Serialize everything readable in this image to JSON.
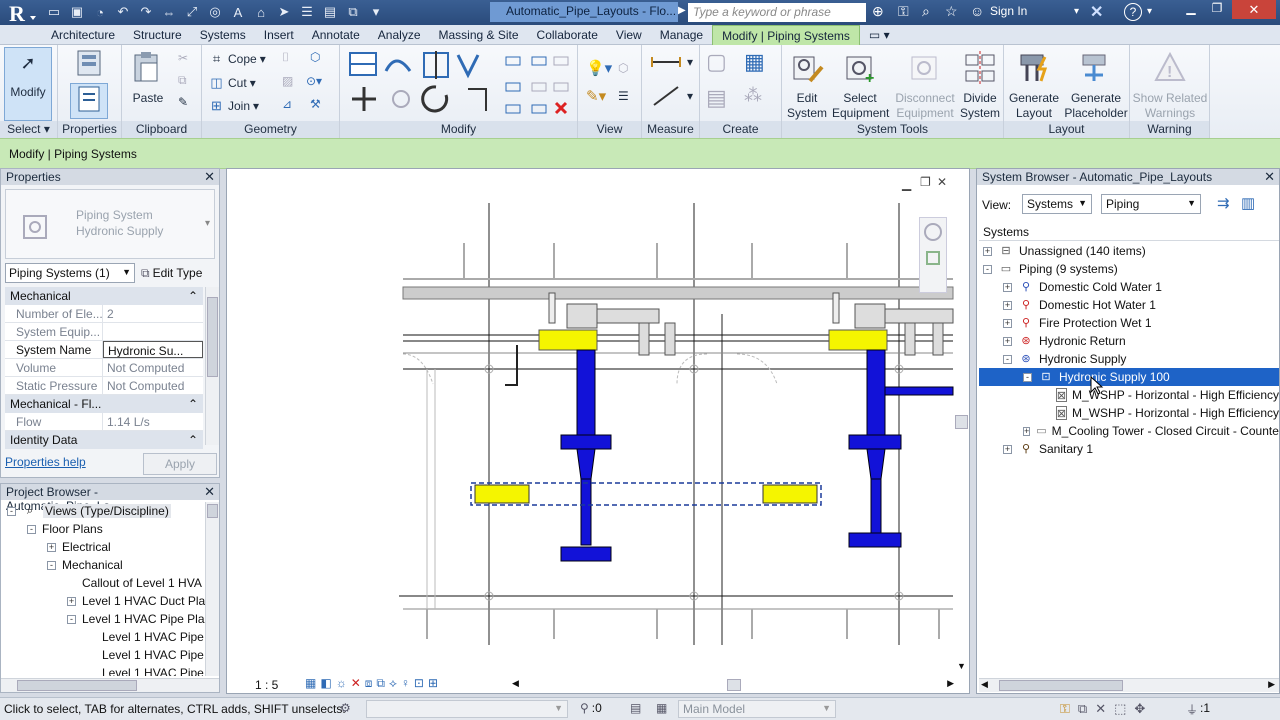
{
  "window": {
    "doc_title": "Automatic_Pipe_Layouts - Flo...",
    "search_placeholder": "Type a keyword or phrase",
    "sign_in": "Sign In"
  },
  "tabs": [
    "Architecture",
    "Structure",
    "Systems",
    "Insert",
    "Annotate",
    "Analyze",
    "Massing & Site",
    "Collaborate",
    "View",
    "Manage",
    "Modify | Piping Systems"
  ],
  "ribbon": {
    "select": {
      "modify": "Modify",
      "label": "Select"
    },
    "properties_label": "Properties",
    "clipboard": {
      "paste": "Paste",
      "label": "Clipboard"
    },
    "geometry": {
      "cope": "Cope",
      "cut": "Cut",
      "join": "Join",
      "label": "Geometry"
    },
    "modify_label": "Modify",
    "view_label": "View",
    "measure_label": "Measure",
    "create_label": "Create",
    "system_tools": {
      "edit_system": "Edit System",
      "select_equipment": "Select Equipment",
      "disconnect_equipment": "Disconnect Equipment",
      "divide_system": "Divide System",
      "label": "System Tools"
    },
    "layout": {
      "generate_layout": "Generate Layout",
      "generate_placeholder": "Generate Placeholder",
      "label": "Layout"
    },
    "warning": {
      "show_related": "Show Related Warnings",
      "label": "Warning"
    }
  },
  "context_bar": "Modify | Piping Systems",
  "properties": {
    "title": "Properties",
    "type_line1": "Piping System",
    "type_line2": "Hydronic Supply",
    "selector": "Piping Systems (1)",
    "edit_type": "Edit Type",
    "group_mechanical": "Mechanical",
    "rows": [
      {
        "k": "Number of Ele...",
        "v": "2"
      },
      {
        "k": "System Equip...",
        "v": ""
      },
      {
        "k": "System Name",
        "v": "Hydronic Su..."
      },
      {
        "k": "Volume",
        "v": "Not Computed"
      },
      {
        "k": "Static Pressure",
        "v": "Not Computed"
      }
    ],
    "group_mech_flow": "Mechanical - Fl...",
    "flow_k": "Flow",
    "flow_v": "1.14 L/s",
    "group_identity": "Identity Data",
    "help": "Properties help",
    "apply": "Apply"
  },
  "project_browser": {
    "title": "Project Browser - Automatic_Pipe_La...",
    "items": [
      {
        "label": "Views (Type/Discipline)",
        "level": 0,
        "exp": "-"
      },
      {
        "label": "Floor Plans",
        "level": 1,
        "exp": "-"
      },
      {
        "label": "Electrical",
        "level": 2,
        "exp": "+"
      },
      {
        "label": "Mechanical",
        "level": 2,
        "exp": "-"
      },
      {
        "label": "Callout of Level 1 HVA",
        "level": 3,
        "exp": ""
      },
      {
        "label": "Level 1 HVAC Duct Pla",
        "level": 3,
        "exp": "+"
      },
      {
        "label": "Level 1 HVAC Pipe Pla",
        "level": 3,
        "exp": "-"
      },
      {
        "label": "Level 1 HVAC Pipe",
        "level": 4,
        "exp": ""
      },
      {
        "label": "Level 1 HVAC Pipe",
        "level": 4,
        "exp": ""
      },
      {
        "label": "Level 1 HVAC Pipe",
        "level": 4,
        "exp": ""
      }
    ]
  },
  "view": {
    "scale": "1 : 5"
  },
  "system_browser": {
    "title": "System Browser - Automatic_Pipe_Layouts",
    "view_label": "View:",
    "view_select": "Systems",
    "discipline_select": "Piping",
    "column_header": "Systems",
    "items": [
      {
        "label": "Unassigned (140 items)",
        "level": 0,
        "exp": "+",
        "icon": "unassigned-icon"
      },
      {
        "label": "Piping (9 systems)",
        "level": 0,
        "exp": "-",
        "icon": "piping-icon"
      },
      {
        "label": "Domestic Cold Water 1",
        "level": 1,
        "exp": "+",
        "icon": "domestic-cold-water-icon"
      },
      {
        "label": "Domestic Hot Water 1",
        "level": 1,
        "exp": "+",
        "icon": "domestic-hot-water-icon"
      },
      {
        "label": "Fire Protection Wet 1",
        "level": 1,
        "exp": "+",
        "icon": "fire-protection-icon"
      },
      {
        "label": "Hydronic Return",
        "level": 1,
        "exp": "+",
        "icon": "hydronic-return-icon"
      },
      {
        "label": "Hydronic Supply",
        "level": 1,
        "exp": "-",
        "icon": "hydronic-supply-icon"
      },
      {
        "label": "Hydronic Supply 100",
        "level": 2,
        "exp": "-",
        "icon": "piping-system-icon",
        "selected": true
      },
      {
        "label": "M_WSHP - Horizontal - High Efficiency",
        "level": 3,
        "exp": "",
        "icon": "equipment-icon"
      },
      {
        "label": "M_WSHP - Horizontal - High Efficiency",
        "level": 3,
        "exp": "",
        "icon": "equipment-icon"
      },
      {
        "label": "M_Cooling Tower - Closed Circuit - Counterflow",
        "level": 2,
        "exp": "+",
        "icon": "folder-icon"
      },
      {
        "label": "Sanitary 1",
        "level": 1,
        "exp": "+",
        "icon": "sanitary-icon"
      }
    ]
  },
  "status": {
    "hint": "Click to select, TAB for alternates, CTRL adds, SHIFT unselects.",
    "count": ":0",
    "model": "Main Model",
    "filter_count": ":1"
  }
}
